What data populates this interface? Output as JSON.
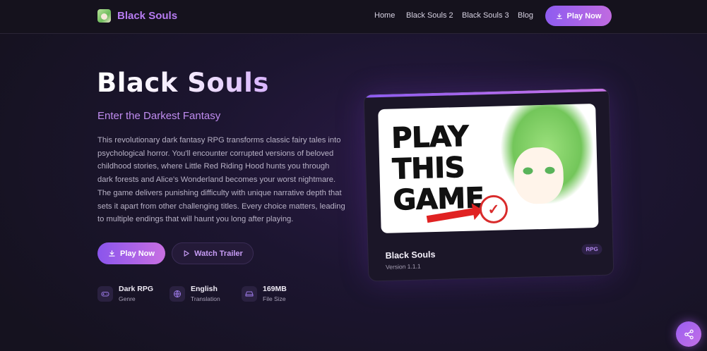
{
  "nav": {
    "logo_text": "Black Souls",
    "links": [
      "Home",
      "Black Souls 2",
      "Black Souls 3",
      "Blog"
    ],
    "cta_label": "Play Now"
  },
  "hero": {
    "title": "Black Souls",
    "subtitle": "Enter the Darkest Fantasy",
    "description": "This revolutionary dark fantasy RPG transforms classic fairy tales into psychological horror. You'll encounter corrupted versions of beloved childhood stories, where Little Red Riding Hood hunts you through dark forests and Alice's Wonderland becomes your worst nightmare. The game delivers punishing difficulty with unique narrative depth that sets it apart from other challenging titles. Every choice matters, leading to multiple endings that will haunt you long after playing.",
    "play_label": "Play Now",
    "trailer_label": "Watch Trailer"
  },
  "meta": [
    {
      "value": "Dark RPG",
      "label": "Genre",
      "icon": "gamepad-icon"
    },
    {
      "value": "English",
      "label": "Translation",
      "icon": "globe-icon"
    },
    {
      "value": "169MB",
      "label": "File Size",
      "icon": "hard-drive-icon"
    }
  ],
  "card": {
    "image_text": "PLAY THIS GAME",
    "title": "Black Souls",
    "version": "Version 1.1.1",
    "badge": "RPG"
  },
  "colors": {
    "accent": "#b77cf2",
    "button_gradient_start": "#8a55ec",
    "button_gradient_end": "#c86fe2",
    "background": "#1c1530"
  }
}
